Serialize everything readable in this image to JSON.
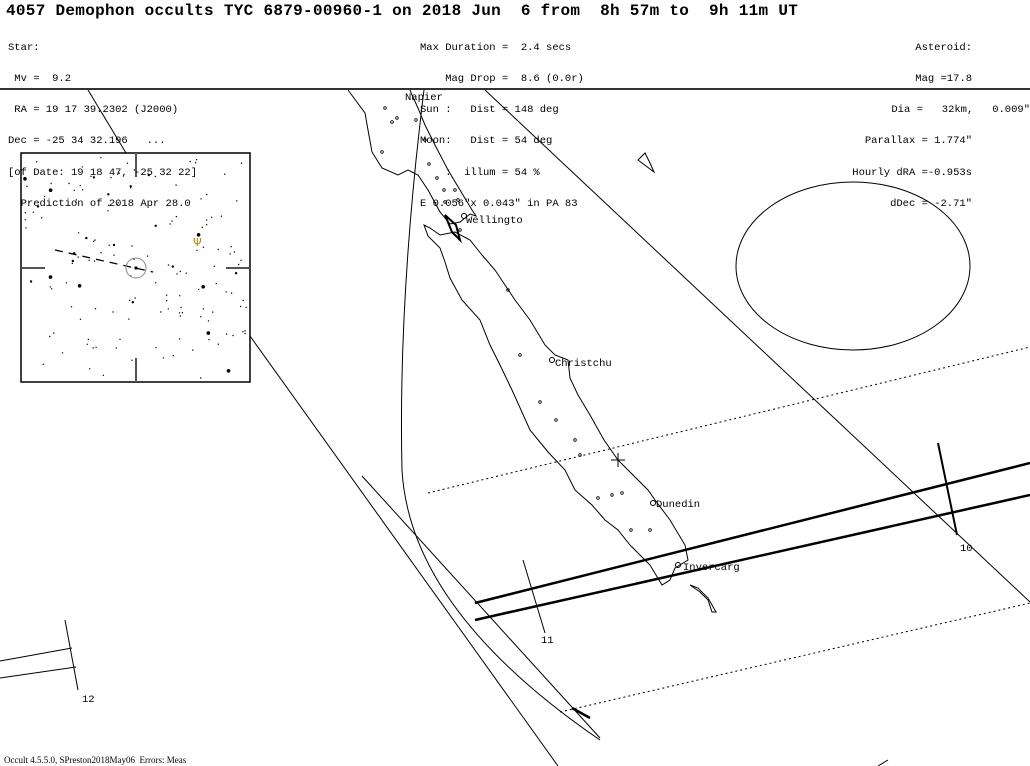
{
  "header": {
    "title": "4057 Demophon occults TYC 6879-00960-1 on 2018 Jun  6 from  8h 57m to  9h 11m UT",
    "star": {
      "label": "Star:",
      "mv": " Mv =  9.2",
      "ra": " RA = 19 17 39.2302 (J2000)",
      "dec": "Dec = -25 34 32.196   ...",
      "of_date": "[of Date: 19 18 47, -25 32 22]",
      "prediction": "  Prediction of 2018 Apr 28.0"
    },
    "event": {
      "max_duration": "Max Duration =  2.4 secs",
      "mag_drop": "    Mag Drop =  8.6 (0.0r)",
      "sun": "Sun :   Dist = 148 deg",
      "moon": "Moon:   Dist = 54 deg",
      "illum": "    :  illum = 54 %",
      "ellipse": "E 0.056\"x 0.043\" in PA 83"
    },
    "asteroid": {
      "label": "Asteroid:",
      "mag": "Mag =17.8",
      "dia": "Dia =   32km,   0.009\"",
      "parallax": "Parallax = 1.774\"",
      "hourly_dra": "Hourly dRA =-0.953s",
      "ddec": "dDec = -2.71\""
    }
  },
  "map": {
    "cities": [
      "Napier",
      "Wellingto",
      "Christchu",
      "Dunedin",
      "Invercarg"
    ],
    "time_marks": [
      "10",
      "11",
      "12"
    ],
    "inset_symbol": "Ψ",
    "colors": {
      "line": "#000000",
      "inset_symbol": "#b8860b"
    }
  },
  "footer": "Occult 4.5.5.0, SPreston2018May06  Errors: Meas"
}
